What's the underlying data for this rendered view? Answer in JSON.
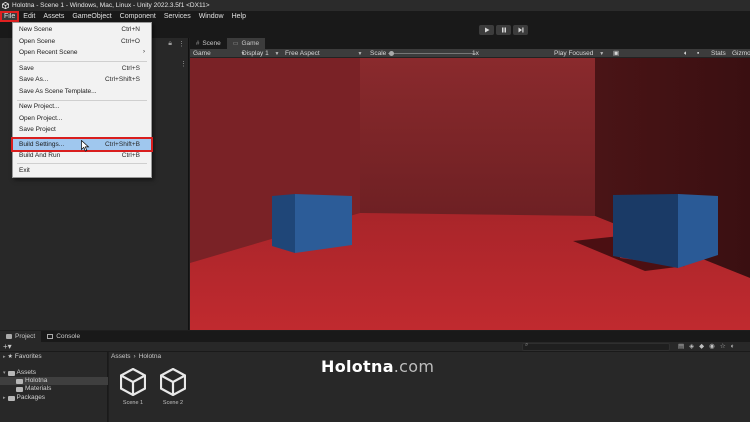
{
  "window": {
    "title": "Holotna - Scene 1 - Windows, Mac, Linux - Unity 2022.3.5f1 <DX11>"
  },
  "menubar": {
    "items": [
      "File",
      "Edit",
      "Assets",
      "GameObject",
      "Component",
      "Services",
      "Window",
      "Help"
    ],
    "active": "File"
  },
  "file_menu": {
    "new_scene": {
      "label": "New Scene",
      "shortcut": "Ctrl+N"
    },
    "open_scene": {
      "label": "Open Scene",
      "shortcut": "Ctrl+O"
    },
    "open_recent_scene": {
      "label": "Open Recent Scene",
      "submenu": "›"
    },
    "save": {
      "label": "Save",
      "shortcut": "Ctrl+S"
    },
    "save_as": {
      "label": "Save As...",
      "shortcut": "Ctrl+Shift+S"
    },
    "save_as_template": {
      "label": "Save As Scene Template..."
    },
    "new_project": {
      "label": "New Project..."
    },
    "open_project": {
      "label": "Open Project..."
    },
    "save_project": {
      "label": "Save Project"
    },
    "build_settings": {
      "label": "Build Settings...",
      "shortcut": "Ctrl+Shift+B",
      "highlighted": true
    },
    "build_and_run": {
      "label": "Build And Run",
      "shortcut": "Ctrl+B"
    },
    "exit": {
      "label": "Exit"
    }
  },
  "view_tabs": {
    "scene": "Scene",
    "game": "Game",
    "active": "Game"
  },
  "game_toolbar": {
    "mode": "Game",
    "display": "Display 1",
    "aspect": "Free Aspect",
    "scale_label": "Scale",
    "scale_value": "1x",
    "play_focused": "Play Focused",
    "stats": "Stats",
    "gizmos": "Gizmos"
  },
  "bottom_tabs": {
    "project": "Project",
    "console": "Console",
    "active": "Project"
  },
  "project_tree": {
    "favorites": "Favorites",
    "assets": "Assets",
    "asset_children": [
      "Holotna",
      "Materials"
    ],
    "selected": "Holotna",
    "packages": "Packages"
  },
  "breadcrumb": {
    "root": "Assets",
    "separator": "›",
    "current": "Holotna"
  },
  "assets": [
    {
      "name": "Scene 1"
    },
    {
      "name": "Scene 2"
    }
  ],
  "watermark": {
    "main": "Holotna",
    "suffix": ".com"
  },
  "colors": {
    "editor_dark": "#191919",
    "panel": "#282828",
    "menu_bg": "#f2f2f2",
    "menu_highlight": "#9fc7ee",
    "annotation_red": "#e02020",
    "room_back_wall": "#7a2528",
    "room_floor": "#b3262b",
    "cube_blue": "#2a5a96"
  }
}
